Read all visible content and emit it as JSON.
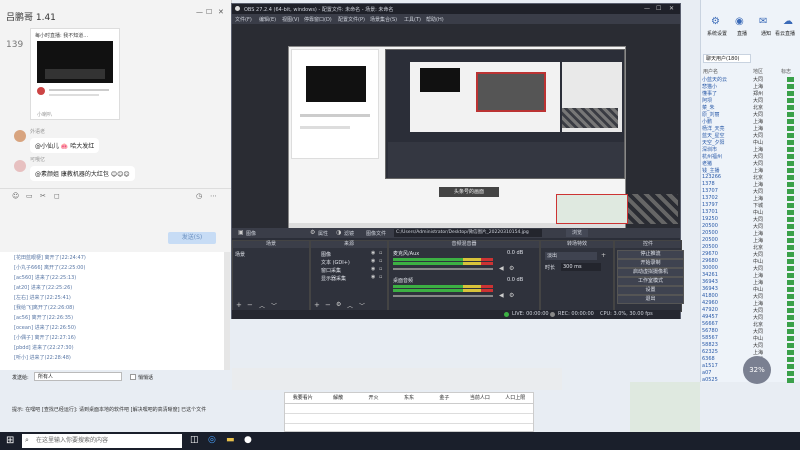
{
  "chat": {
    "title": "吕鹏哥 1.41",
    "post_label": "每小时直播: 我不知道...",
    "post_count": "139",
    "small_note": "小喇叭",
    "msg1_sender": "外语老",
    "msg1_text": "@小仙儿 🐽 哈大发红",
    "msg2_sender": "可哦亿",
    "msg2_text": "@素颜姐 康教机器的大红包 😊😊😊",
    "send_label": "发送(S)"
  },
  "log": {
    "lines": [
      "[花田蓝眼梗] 离开了(22:24:47)",
      "[小丸子666] 离开了(22:25:00)",
      "[ac560] 进来了(22:25:13)",
      "[at20] 进来了(22:25:26)",
      "[左右] 进来了(22:25:41)",
      "[我给飞]离开了(22:26:08)",
      "[ac56] 离开了(22:26:35)",
      "[ocean] 进来了(22:26:50)",
      "[小偶子] 离开了(22:27:16)",
      "[pbdd] 进来了(22:27:30)",
      "[听小] 进来了(22:28:48)"
    ],
    "send_to_label": "发送给:",
    "send_to_value": "所有人",
    "private_label": "悄悄话",
    "tip": "提示: 在嘿吧 [查找已经运行]: 请到桌面本地的软件吧 [解决嘿吧的高清晰度] 已这个文件"
  },
  "obs": {
    "title": "OBS 27.2.4 (64-bit, windows) - 配置文件: 未命名 - 场景: 未命名",
    "menu": [
      "文件(F)",
      "编辑(E)",
      "视图(V)",
      "停靠窗口(D)",
      "配置文件(P)",
      "场景集合(S)",
      "工具(T)",
      "帮助(H)"
    ],
    "screen_label": "头条号的画面",
    "source_bar": {
      "image_label": "图像",
      "props": "属性",
      "filters": "滤镜",
      "image_file": "图像文件",
      "path": "C:/Users/Administrator/Desktop/微信图片_20220310154.jpg",
      "browse": "浏览"
    },
    "panels": {
      "scenes": "场景",
      "sources": "来源",
      "mixer": "音频混音器",
      "transitions": "转场特效",
      "controls": "控件"
    },
    "scene_item": "场景",
    "source_items": [
      "图像",
      "文本 (GDI+)",
      "窗口采集",
      "显示器采集"
    ],
    "mixer": {
      "desktop_label": "桌面音频",
      "desktop_db": "0.0 dB",
      "mic_label": "麦克风/Aux",
      "mic_db": "0.0 dB"
    },
    "transitions": {
      "type": "淡出",
      "duration_label": "时长",
      "duration_value": "300 ms"
    },
    "controls": [
      "停止推流",
      "开始录制",
      "启动虚拟摄像机",
      "工作室模式",
      "设置",
      "退出"
    ],
    "status": {
      "live": "LIVE: 00:00:00",
      "rec": "REC: 00:00:00",
      "cpu": "CPU: 3.0%, 30.00 fps"
    }
  },
  "contacts": {
    "tabs": [
      "系统设置",
      "直播",
      "通知",
      "看云直播"
    ],
    "list_header": "聊天用户(180)",
    "columns": [
      "用户名",
      "地区",
      "标志"
    ],
    "users": [
      {
        "name": "小蓝天的云",
        "loc": "大同"
      },
      {
        "name": "悲猫小",
        "loc": "上海"
      },
      {
        "name": "懂事了",
        "loc": "郑州"
      },
      {
        "name": "阿坝",
        "loc": "大同"
      },
      {
        "name": "菜_朱",
        "loc": "北京"
      },
      {
        "name": "原_刘丽",
        "loc": "大同"
      },
      {
        "name": "小鹏",
        "loc": "上海"
      },
      {
        "name": "杨洋_天亮",
        "loc": "上海"
      },
      {
        "name": "蓝天_星空",
        "loc": "大同"
      },
      {
        "name": "天空_夕阳",
        "loc": "中山"
      },
      {
        "name": "深圳市",
        "loc": "上海"
      },
      {
        "name": "杭州福州",
        "loc": "大同"
      },
      {
        "name": "老猪",
        "loc": "大同"
      },
      {
        "name": "钱_主播",
        "loc": "上海"
      },
      {
        "name": "123266",
        "loc": "北京"
      },
      {
        "name": "1378",
        "loc": "上海"
      },
      {
        "name": "13707",
        "loc": "大同"
      },
      {
        "name": "13702",
        "loc": "上海"
      },
      {
        "name": "13797",
        "loc": "下城"
      },
      {
        "name": "13701",
        "loc": "中山"
      },
      {
        "name": "19250",
        "loc": "大同"
      },
      {
        "name": "20500",
        "loc": "大同"
      },
      {
        "name": "20500",
        "loc": "上海"
      },
      {
        "name": "20500",
        "loc": "上海"
      },
      {
        "name": "20500",
        "loc": "北京"
      },
      {
        "name": "29670",
        "loc": "大同"
      },
      {
        "name": "29680",
        "loc": "中山"
      },
      {
        "name": "30000",
        "loc": "大同"
      },
      {
        "name": "34261",
        "loc": "上海"
      },
      {
        "name": "36943",
        "loc": "上海"
      },
      {
        "name": "36943",
        "loc": "中山"
      },
      {
        "name": "41800",
        "loc": "大同"
      },
      {
        "name": "42960",
        "loc": "上海"
      },
      {
        "name": "47920",
        "loc": "大同"
      },
      {
        "name": "49457",
        "loc": "大同"
      },
      {
        "name": "56667",
        "loc": "北京"
      },
      {
        "name": "56780",
        "loc": "大同"
      },
      {
        "name": "58567",
        "loc": "中山"
      },
      {
        "name": "58823",
        "loc": "大同"
      },
      {
        "name": "62325",
        "loc": "上海"
      },
      {
        "name": "6368",
        "loc": "大同"
      },
      {
        "name": "a1517",
        "loc": "中山"
      },
      {
        "name": "a07",
        "loc": "北京"
      },
      {
        "name": "a0525",
        "loc": "上海"
      }
    ],
    "speed_badge": "32%"
  },
  "spreadsheet": {
    "headers": [
      "我要看片",
      "解散",
      "开火",
      "东东",
      "金子",
      "当前人口",
      "人口上限"
    ]
  },
  "taskbar": {
    "search_placeholder": "在这里输入你要搜索的内容"
  },
  "colors": {
    "obs_bg": "#2b2e38",
    "meter_green": "#3cb043",
    "meter_yellow": "#d8c33a",
    "meter_red": "#c33",
    "link_blue": "#2a5aa8"
  }
}
